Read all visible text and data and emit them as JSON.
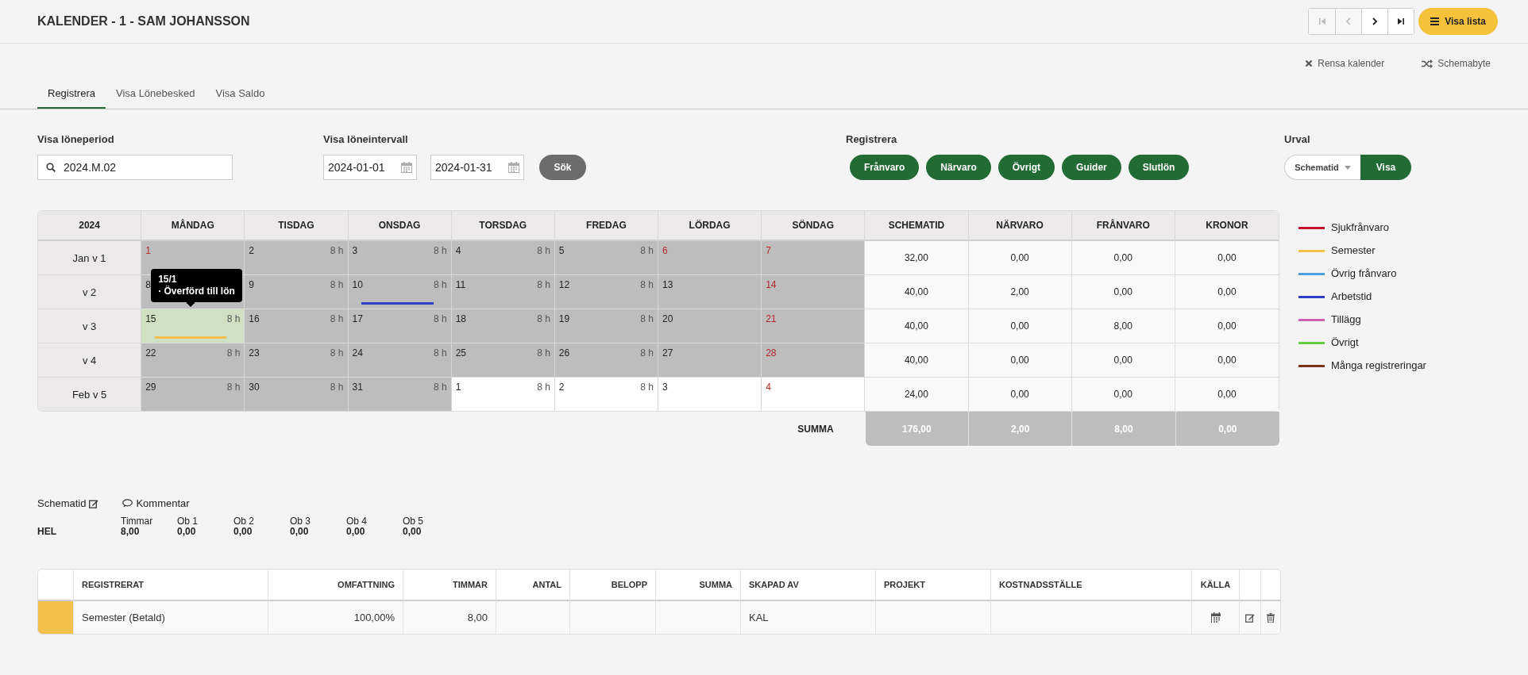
{
  "header": {
    "title": "KALENDER - 1 - SAM JOHANSSON",
    "nav_buttons": [
      {
        "kind": "first",
        "disabled": true
      },
      {
        "kind": "prev",
        "disabled": true
      },
      {
        "kind": "next",
        "disabled": false
      },
      {
        "kind": "last",
        "disabled": false
      }
    ],
    "list_button": "Visa lista"
  },
  "actions": [
    {
      "kind": "clear",
      "label": "Rensa kalender"
    },
    {
      "kind": "shuffle",
      "label": "Schemabyte"
    }
  ],
  "tabs": [
    {
      "label": "Registrera",
      "selected": true
    },
    {
      "label": "Visa Lönebesked",
      "selected": false
    },
    {
      "label": "Visa Saldo",
      "selected": false
    }
  ],
  "filters": {
    "period": {
      "label": "Visa löneperiod",
      "value": "2024.M.02"
    },
    "interval": {
      "label": "Visa löneintervall",
      "from": "2024-01-01",
      "to": "2024-01-31",
      "button": "Sök"
    },
    "register": {
      "label": "Registrera",
      "buttons": [
        "Frånvaro",
        "Närvaro",
        "Övrigt",
        "Guider",
        "Slutlön"
      ]
    },
    "selection": {
      "label": "Urval",
      "dropdown": "Schematid",
      "button": "Visa"
    }
  },
  "calendar": {
    "corner": "2024",
    "day_columns": [
      "MÅNDAG",
      "TISDAG",
      "ONSDAG",
      "TORSDAG",
      "FREDAG",
      "LÖRDAG",
      "SÖNDAG"
    ],
    "summary_columns": [
      "SCHEMATID",
      "NÄRVARO",
      "FRÅNVARO",
      "KRONOR"
    ],
    "weeks": [
      {
        "label": "Jan v 1",
        "days": [
          {
            "day": "1",
            "holiday": true,
            "shaded": true,
            "selected": false
          },
          {
            "day": "2",
            "hours": "8 h",
            "holiday": false,
            "shaded": true,
            "selected": false
          },
          {
            "day": "3",
            "hours": "8 h",
            "holiday": false,
            "shaded": true,
            "selected": false
          },
          {
            "day": "4",
            "hours": "8 h",
            "holiday": false,
            "shaded": true,
            "selected": false
          },
          {
            "day": "5",
            "hours": "8 h",
            "holiday": false,
            "shaded": true,
            "selected": false
          },
          {
            "day": "6",
            "holiday": true,
            "shaded": true,
            "selected": false
          },
          {
            "day": "7",
            "holiday": true,
            "shaded": true,
            "selected": false
          }
        ],
        "totals": [
          "32,00",
          "0,00",
          "0,00",
          "0,00"
        ]
      },
      {
        "label": "v 2",
        "days": [
          {
            "day": "8",
            "holiday": false,
            "shaded": true,
            "selected": false
          },
          {
            "day": "9",
            "hours": "8 h",
            "holiday": false,
            "shaded": true,
            "selected": false
          },
          {
            "day": "10",
            "hours": "8 h",
            "holiday": false,
            "shaded": true,
            "selected": false,
            "bar": {
              "color": "#2f3fc4"
            }
          },
          {
            "day": "11",
            "hours": "8 h",
            "holiday": false,
            "shaded": true,
            "selected": false
          },
          {
            "day": "12",
            "hours": "8 h",
            "holiday": false,
            "shaded": true,
            "selected": false
          },
          {
            "day": "13",
            "holiday": false,
            "shaded": true,
            "selected": false
          },
          {
            "day": "14",
            "holiday": true,
            "shaded": true,
            "selected": false
          }
        ],
        "totals": [
          "40,00",
          "2,00",
          "0,00",
          "0,00"
        ]
      },
      {
        "label": "v 3",
        "days": [
          {
            "day": "15",
            "hours": "8 h",
            "holiday": false,
            "shaded": true,
            "selected": true,
            "bar": {
              "color": "#f2c04b"
            },
            "tooltip": {
              "title": "15/1",
              "text": "· Överförd till lön"
            }
          },
          {
            "day": "16",
            "hours": "8 h",
            "holiday": false,
            "shaded": true,
            "selected": false
          },
          {
            "day": "17",
            "hours": "8 h",
            "holiday": false,
            "shaded": true,
            "selected": false
          },
          {
            "day": "18",
            "hours": "8 h",
            "holiday": false,
            "shaded": true,
            "selected": false
          },
          {
            "day": "19",
            "hours": "8 h",
            "holiday": false,
            "shaded": true,
            "selected": false
          },
          {
            "day": "20",
            "holiday": false,
            "shaded": true,
            "selected": false
          },
          {
            "day": "21",
            "holiday": true,
            "shaded": true,
            "selected": false
          }
        ],
        "totals": [
          "40,00",
          "0,00",
          "8,00",
          "0,00"
        ]
      },
      {
        "label": "v 4",
        "days": [
          {
            "day": "22",
            "hours": "8 h",
            "holiday": false,
            "shaded": true,
            "selected": false
          },
          {
            "day": "23",
            "hours": "8 h",
            "holiday": false,
            "shaded": true,
            "selected": false
          },
          {
            "day": "24",
            "hours": "8 h",
            "holiday": false,
            "shaded": true,
            "selected": false
          },
          {
            "day": "25",
            "hours": "8 h",
            "holiday": false,
            "shaded": true,
            "selected": false
          },
          {
            "day": "26",
            "hours": "8 h",
            "holiday": false,
            "shaded": true,
            "selected": false
          },
          {
            "day": "27",
            "holiday": false,
            "shaded": true,
            "selected": false
          },
          {
            "day": "28",
            "holiday": true,
            "shaded": true,
            "selected": false
          }
        ],
        "totals": [
          "40,00",
          "0,00",
          "0,00",
          "0,00"
        ]
      },
      {
        "label": "Feb v 5",
        "days": [
          {
            "day": "29",
            "hours": "8 h",
            "holiday": false,
            "shaded": true,
            "selected": false
          },
          {
            "day": "30",
            "hours": "8 h",
            "holiday": false,
            "shaded": true,
            "selected": false
          },
          {
            "day": "31",
            "hours": "8 h",
            "holiday": false,
            "shaded": true,
            "selected": false
          },
          {
            "day": "1",
            "hours": "8 h",
            "holiday": false,
            "shaded": false,
            "selected": false
          },
          {
            "day": "2",
            "hours": "8 h",
            "holiday": false,
            "shaded": false,
            "selected": false
          },
          {
            "day": "3",
            "holiday": false,
            "shaded": false,
            "selected": false
          },
          {
            "day": "4",
            "holiday": true,
            "shaded": false,
            "selected": false
          }
        ],
        "totals": [
          "24,00",
          "0,00",
          "0,00",
          "0,00"
        ]
      }
    ],
    "sum_label": "SUMMA",
    "sums": [
      "176,00",
      "2,00",
      "8,00",
      "0,00"
    ]
  },
  "legend": [
    {
      "label": "Sjukfrånvaro",
      "color": "#c8102e"
    },
    {
      "label": "Semester",
      "color": "#f2c04b"
    },
    {
      "label": "Övrig frånvaro",
      "color": "#4a9fdc"
    },
    {
      "label": "Arbetstid",
      "color": "#2f3fc4"
    },
    {
      "label": "Tillägg",
      "color": "#d160b8"
    },
    {
      "label": "Övrigt",
      "color": "#5fcf3f"
    },
    {
      "label": "Många registreringar",
      "color": "#7a3518"
    }
  ],
  "details": {
    "schedule_link": "Schematid",
    "comment_link": "Kommentar",
    "row_label": "HEL",
    "stats": [
      {
        "label": "Timmar",
        "value": "8,00"
      },
      {
        "label": "Ob 1",
        "value": "0,00"
      },
      {
        "label": "Ob 2",
        "value": "0,00"
      },
      {
        "label": "Ob 3",
        "value": "0,00"
      },
      {
        "label": "Ob 4",
        "value": "0,00"
      },
      {
        "label": "Ob 5",
        "value": "0,00"
      }
    ]
  },
  "registrations": {
    "columns": [
      "REGISTRERAT",
      "OMFATTNING",
      "TIMMAR",
      "ANTAL",
      "BELOPP",
      "SUMMA",
      "SKAPAD AV",
      "PROJEKT",
      "KOSTNADSSTÄLLE",
      "KÄLLA"
    ],
    "rows": [
      {
        "color": "#f2c04b",
        "registrerat": "Semester (Betald)",
        "omfattning": "100,00%",
        "timmar": "8,00",
        "skapad_av": "KAL"
      }
    ]
  }
}
